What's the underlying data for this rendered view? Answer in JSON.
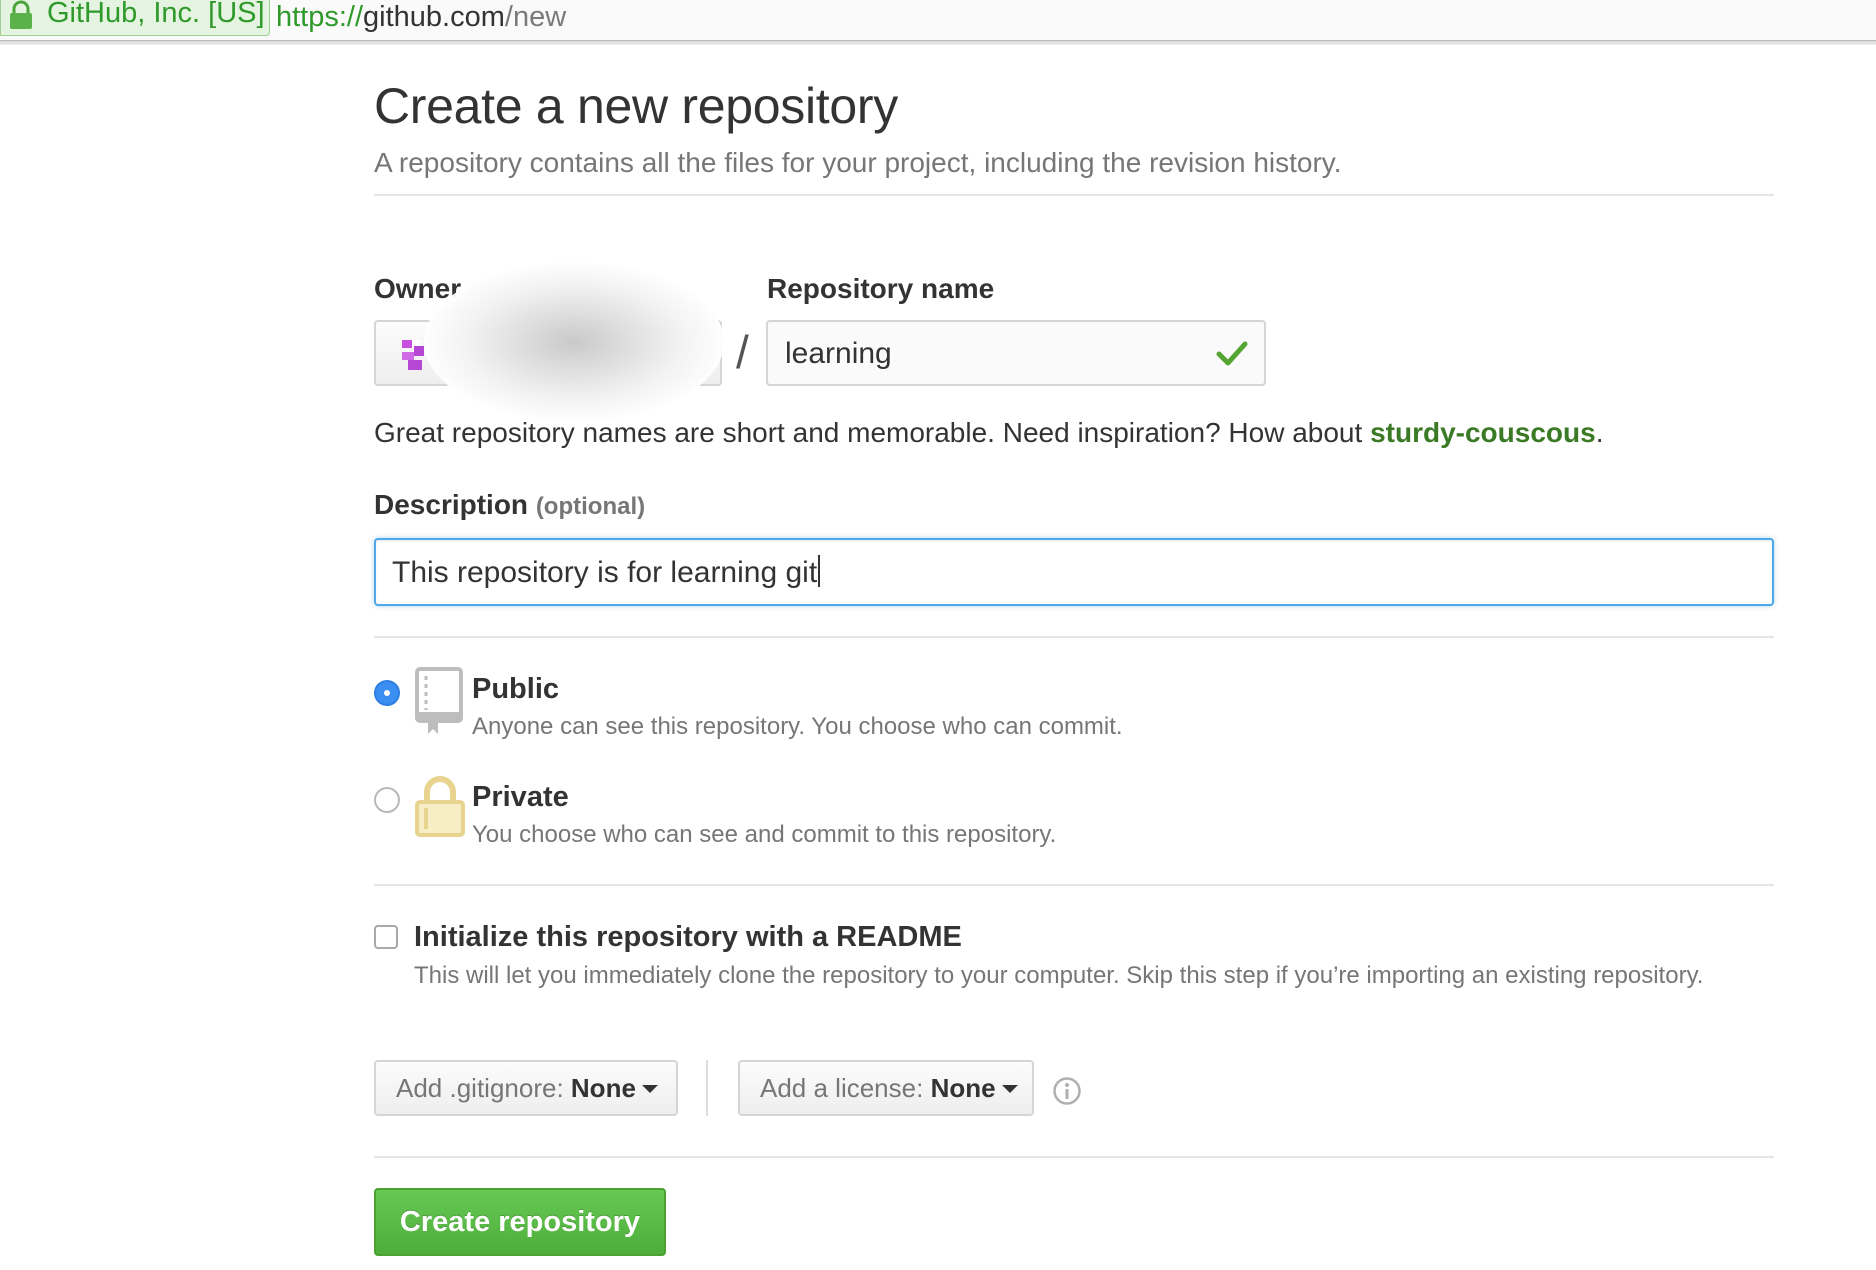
{
  "browser": {
    "ev_label": "GitHub, Inc. [US]",
    "url_scheme": "https://",
    "url_host": "github.com",
    "url_path": "/new"
  },
  "page": {
    "title": "Create a new repository",
    "subtitle": "A repository contains all the files for your project, including the revision history."
  },
  "form": {
    "owner_label": "Owner",
    "owner_avatar_icon": "identicon-avatar",
    "separator": "/",
    "repo_name_label": "Repository name",
    "repo_name_value": "learning",
    "repo_name_valid_icon": "check-icon",
    "hint_text": "Great repository names are short and memorable. Need inspiration? How about ",
    "hint_suggestion": "sturdy-couscous",
    "hint_end": ".",
    "description_label": "Description",
    "description_optional": "(optional)",
    "description_value": "This repository is for learning git"
  },
  "visibility": {
    "selected": "public",
    "public": {
      "title": "Public",
      "note": "Anyone can see this repository. You choose who can commit.",
      "icon": "repo-book-icon"
    },
    "private": {
      "title": "Private",
      "note": "You choose who can see and commit to this repository.",
      "icon": "lock-icon"
    }
  },
  "init": {
    "checked": false,
    "title": "Initialize this repository with a README",
    "note": "This will let you immediately clone the repository to your computer. Skip this step if you’re importing an existing repository."
  },
  "gitignore": {
    "label": "Add .gitignore:",
    "value": "None"
  },
  "license": {
    "label": "Add a license:",
    "value": "None"
  },
  "submit": {
    "label": "Create repository"
  },
  "colors": {
    "accent_blue": "#3b8ff3",
    "success_green": "#4fae3b",
    "suggestion_green": "#3b7a25",
    "ev_green": "#2f9a2b"
  }
}
